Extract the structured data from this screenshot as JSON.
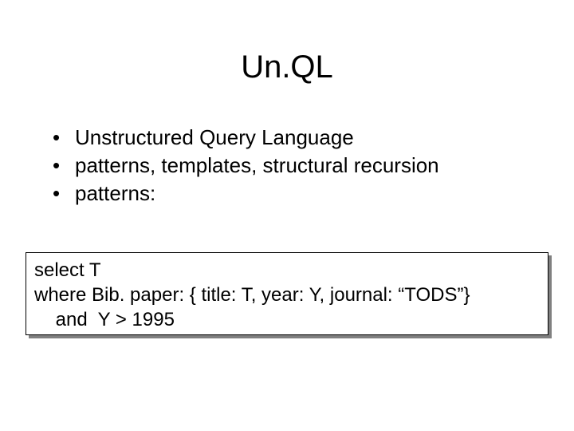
{
  "title": "Un.QL",
  "bullets": [
    "Unstructured Query Language",
    "patterns, templates, structural recursion",
    "patterns:"
  ],
  "code": {
    "line1": "select T",
    "line2": "where Bib. paper: { title: T, year: Y, journal: “TODS”}",
    "line3": "    and  Y > 1995"
  }
}
